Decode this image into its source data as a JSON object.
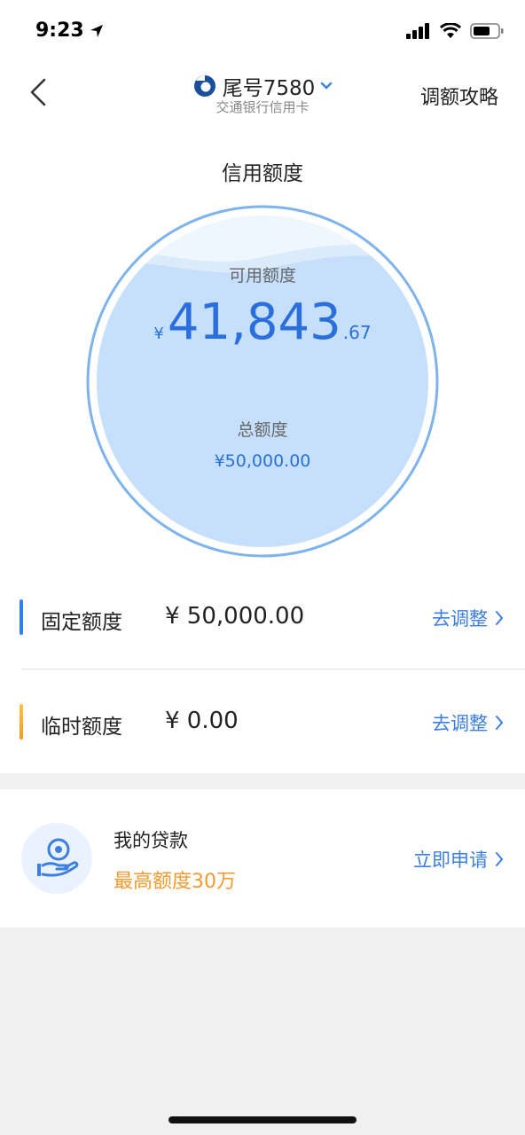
{
  "status_bar": {
    "time": "9:23"
  },
  "nav": {
    "title": "尾号7580",
    "subtitle": "交通银行信用卡",
    "right_action": "调额攻略"
  },
  "credit": {
    "section_title": "信用额度",
    "available_label": "可用额度",
    "available_currency": "¥",
    "available_integer": "41,843",
    "available_decimal": ".67",
    "total_label": "总额度",
    "total_amount": "¥50,000.00"
  },
  "quotas": [
    {
      "label": "固定额度",
      "value": "¥ 50,000.00",
      "action": "去调整",
      "color": "#2f80ed"
    },
    {
      "label": "临时额度",
      "value": "¥ 0.00",
      "action": "去调整",
      "color": "#f5a623"
    }
  ],
  "loan": {
    "title": "我的贷款",
    "subtitle": "最高额度30万",
    "action": "立即申请"
  },
  "colors": {
    "accent": "#3d7fe0",
    "orange": "#f29a2e",
    "gauge_fill": "#c6e0fb"
  }
}
